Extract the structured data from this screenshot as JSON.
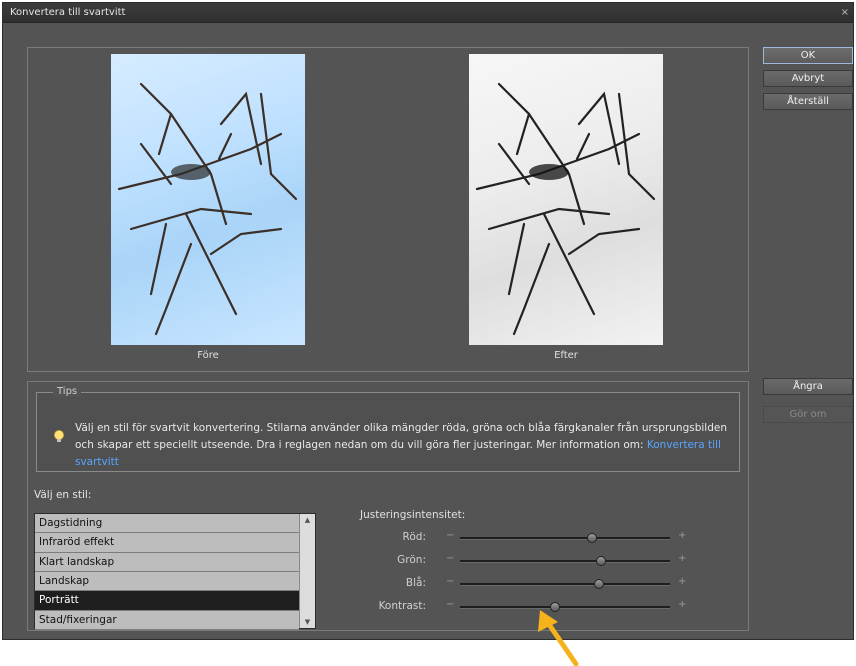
{
  "window": {
    "title": "Konvertera till svartvitt",
    "close_glyph": "×"
  },
  "preview": {
    "before_label": "Före",
    "after_label": "Efter"
  },
  "buttons": {
    "ok": "OK",
    "cancel": "Avbryt",
    "reset": "Återställ",
    "undo": "Ångra",
    "redo": "Gör om"
  },
  "tips": {
    "title": "Tips",
    "text": "Välj en stil för svartvit konvertering. Stilarna använder olika mängder röda, gröna och blåa färgkanaler från ursprungsbilden och skapar ett speciellt utseende. Dra i reglagen nedan om du vill göra fler justeringar. Mer information om:",
    "link": "Konvertera till svartvitt",
    "icon": "lightbulb-icon"
  },
  "styles": {
    "label": "Välj en stil:",
    "items": [
      "Dagstidning",
      "Infraröd effekt",
      "Klart landskap",
      "Landskap",
      "Porträtt",
      "Stad/fixeringar"
    ],
    "selected": "Porträtt"
  },
  "adjustments": {
    "label": "Justeringsintensitet:",
    "minus": "−",
    "plus": "+",
    "sliders": [
      {
        "name": "Röd:",
        "value": 0.63
      },
      {
        "name": "Grön:",
        "value": 0.67
      },
      {
        "name": "Blå:",
        "value": 0.66
      },
      {
        "name": "Kontrast:",
        "value": 0.45
      }
    ]
  },
  "colors": {
    "accent_link": "#58a6ff",
    "arrow": "#f5b21b",
    "selected_row": "#1e1e1e"
  }
}
